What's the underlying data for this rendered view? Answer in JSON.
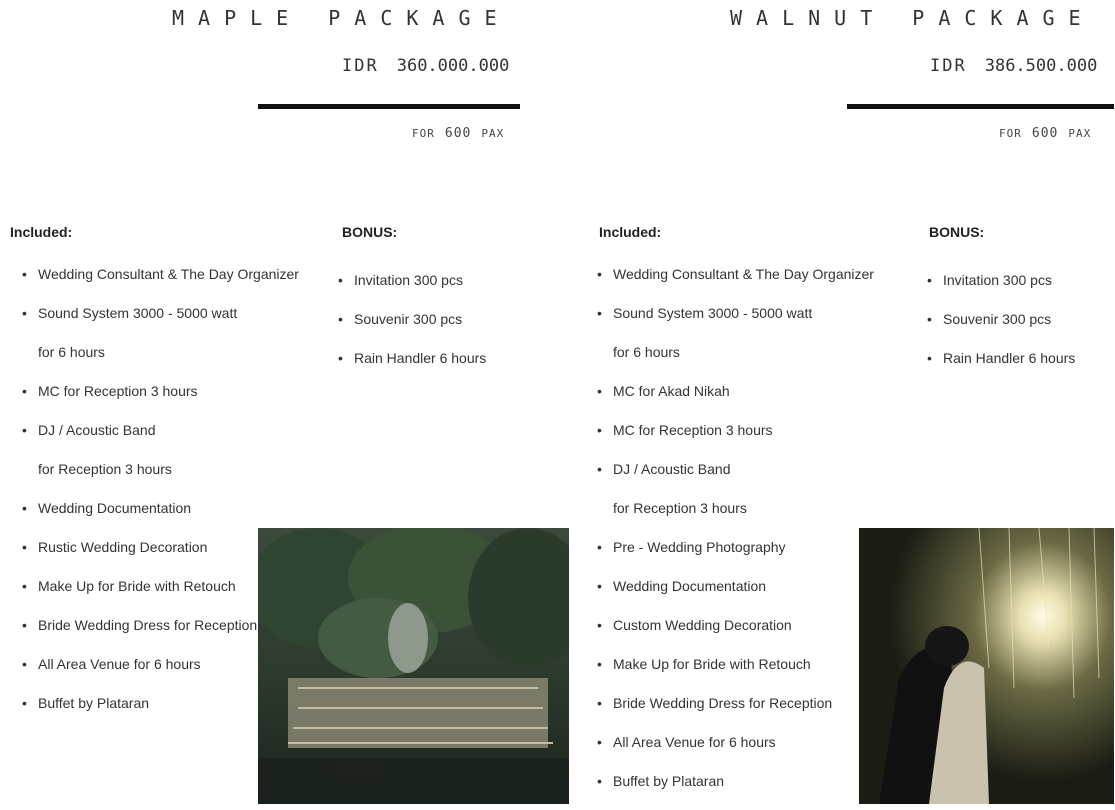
{
  "maple": {
    "title": "MAPLE PACKAGE",
    "currency": "IDR",
    "price": "360.000.000",
    "pax_prefix": "FOR",
    "pax_count": "600",
    "pax_unit": "PAX",
    "included_heading": "Included:",
    "included": [
      {
        "text": "Wedding Consultant & The Day Organizer",
        "bullet": true
      },
      {
        "text": "Sound System 3000 - 5000 watt",
        "bullet": true
      },
      {
        "text": "for 6 hours",
        "bullet": false
      },
      {
        "text": "MC for Reception 3 hours",
        "bullet": true
      },
      {
        "text": "DJ / Acoustic Band",
        "bullet": true
      },
      {
        "text": "for Reception 3 hours",
        "bullet": false
      },
      {
        "text": "Wedding Documentation",
        "bullet": true
      },
      {
        "text": "Rustic Wedding Decoration",
        "bullet": true
      },
      {
        "text": "Make Up for Bride with Retouch",
        "bullet": true
      },
      {
        "text": "Bride Wedding Dress for Reception",
        "bullet": true
      },
      {
        "text": "All Area Venue for 6 hours",
        "bullet": true
      },
      {
        "text": "Buffet by Plataran",
        "bullet": true
      }
    ],
    "bonus_heading": "BONUS:",
    "bonus": [
      "Invitation 300 pcs",
      "Souvenir 300 pcs",
      "Rain Handler 6 hours"
    ]
  },
  "walnut": {
    "title": "WALNUT PACKAGE",
    "currency": "IDR",
    "price": "386.500.000",
    "pax_prefix": "FOR",
    "pax_count": "600",
    "pax_unit": "PAX",
    "included_heading": "Included:",
    "included": [
      {
        "text": "Wedding Consultant & The Day Organizer",
        "bullet": true
      },
      {
        "text": "Sound System 3000 - 5000 watt",
        "bullet": true
      },
      {
        "text": "for 6 hours",
        "bullet": false
      },
      {
        "text": "MC for Akad Nikah",
        "bullet": true
      },
      {
        "text": "MC for Reception 3 hours",
        "bullet": true
      },
      {
        "text": "DJ / Acoustic Band",
        "bullet": true
      },
      {
        "text": "for Reception 3 hours",
        "bullet": false
      },
      {
        "text": "Pre - Wedding Photography",
        "bullet": true
      },
      {
        "text": "Wedding Documentation",
        "bullet": true
      },
      {
        "text": "Custom Wedding Decoration",
        "bullet": true
      },
      {
        "text": "Make Up for Bride with Retouch",
        "bullet": true
      },
      {
        "text": "Bride Wedding Dress for Reception",
        "bullet": true
      },
      {
        "text": "All Area Venue for 6 hours",
        "bullet": true
      },
      {
        "text": "Buffet by Plataran",
        "bullet": true
      }
    ],
    "bonus_heading": "BONUS:",
    "bonus": [
      "Invitation 300 pcs",
      "Souvenir 300 pcs",
      "Rain Handler 6 hours"
    ]
  },
  "bullet_glyph": "•",
  "colors": {
    "text": "#333333",
    "rule": "#111111"
  }
}
